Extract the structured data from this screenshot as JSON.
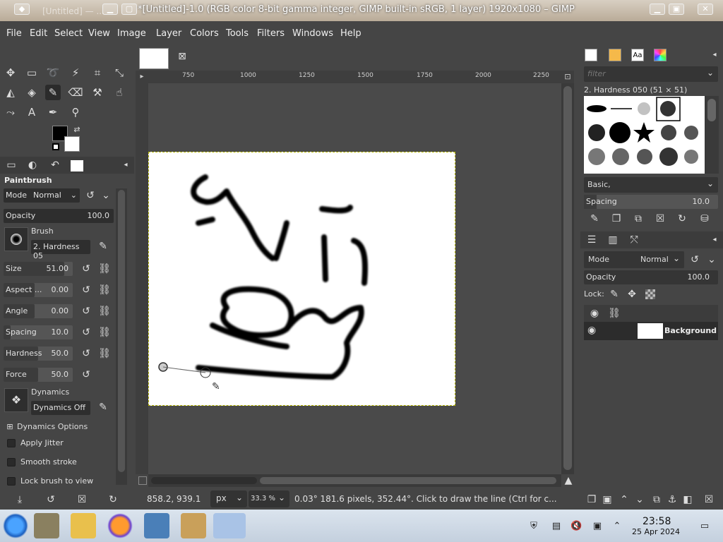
{
  "window": {
    "title": "*[Untitled]-1.0 (RGB color 8-bit gamma integer, GIMP built-in sRGB, 1 layer) 1920x1080 – GIMP",
    "ghost_text": "[Untitled] — ..."
  },
  "menu": [
    "File",
    "Edit",
    "Select",
    "View",
    "Image",
    "Layer",
    "Colors",
    "Tools",
    "Filters",
    "Windows",
    "Help"
  ],
  "tool_options": {
    "title": "Paintbrush",
    "mode_label": "Mode",
    "mode_value": "Normal",
    "opacity_label": "Opacity",
    "opacity_value": "100.0",
    "brush_label": "Brush",
    "brush_name": "2. Hardness 05",
    "size_label": "Size",
    "size_value": "51.00",
    "aspect_label": "Aspect ...",
    "aspect_value": "0.00",
    "angle_label": "Angle",
    "angle_value": "0.00",
    "spacing_label": "Spacing",
    "spacing_value": "10.0",
    "hardness_label": "Hardness",
    "hardness_value": "50.0",
    "force_label": "Force",
    "force_value": "50.0",
    "dynamics_label": "Dynamics",
    "dynamics_value": "Dynamics Off",
    "dynamics_options": "Dynamics Options",
    "apply_jitter": "Apply Jitter",
    "smooth_stroke": "Smooth stroke",
    "lock_brush": "Lock brush to view"
  },
  "ruler": {
    "h_ticks": [
      "750",
      "1000",
      "1250",
      "1500",
      "1750",
      "2000",
      "2250"
    ]
  },
  "status": {
    "coords": "858.2, 939.1",
    "unit": "px",
    "zoom": "33.3 %",
    "message": "0.03°  181.6 pixels, 352.44°. Click to draw the line (Ctrl for c..."
  },
  "brushes": {
    "filter_placeholder": "filter",
    "selected": "2. Hardness 050 (51 × 51)",
    "tag": "Basic,",
    "spacing_label": "Spacing",
    "spacing_value": "10.0"
  },
  "layers": {
    "mode_label": "Mode",
    "mode_value": "Normal",
    "opacity_label": "Opacity",
    "opacity_value": "100.0",
    "lock_label": "Lock:",
    "layer_name": "Background"
  },
  "taskbar": {
    "time": "23:58",
    "date": "25 Apr 2024"
  },
  "colors": {
    "accent_title": "#c4b7a6",
    "panel": "#454545",
    "canvas_selection": "#b8b800"
  }
}
